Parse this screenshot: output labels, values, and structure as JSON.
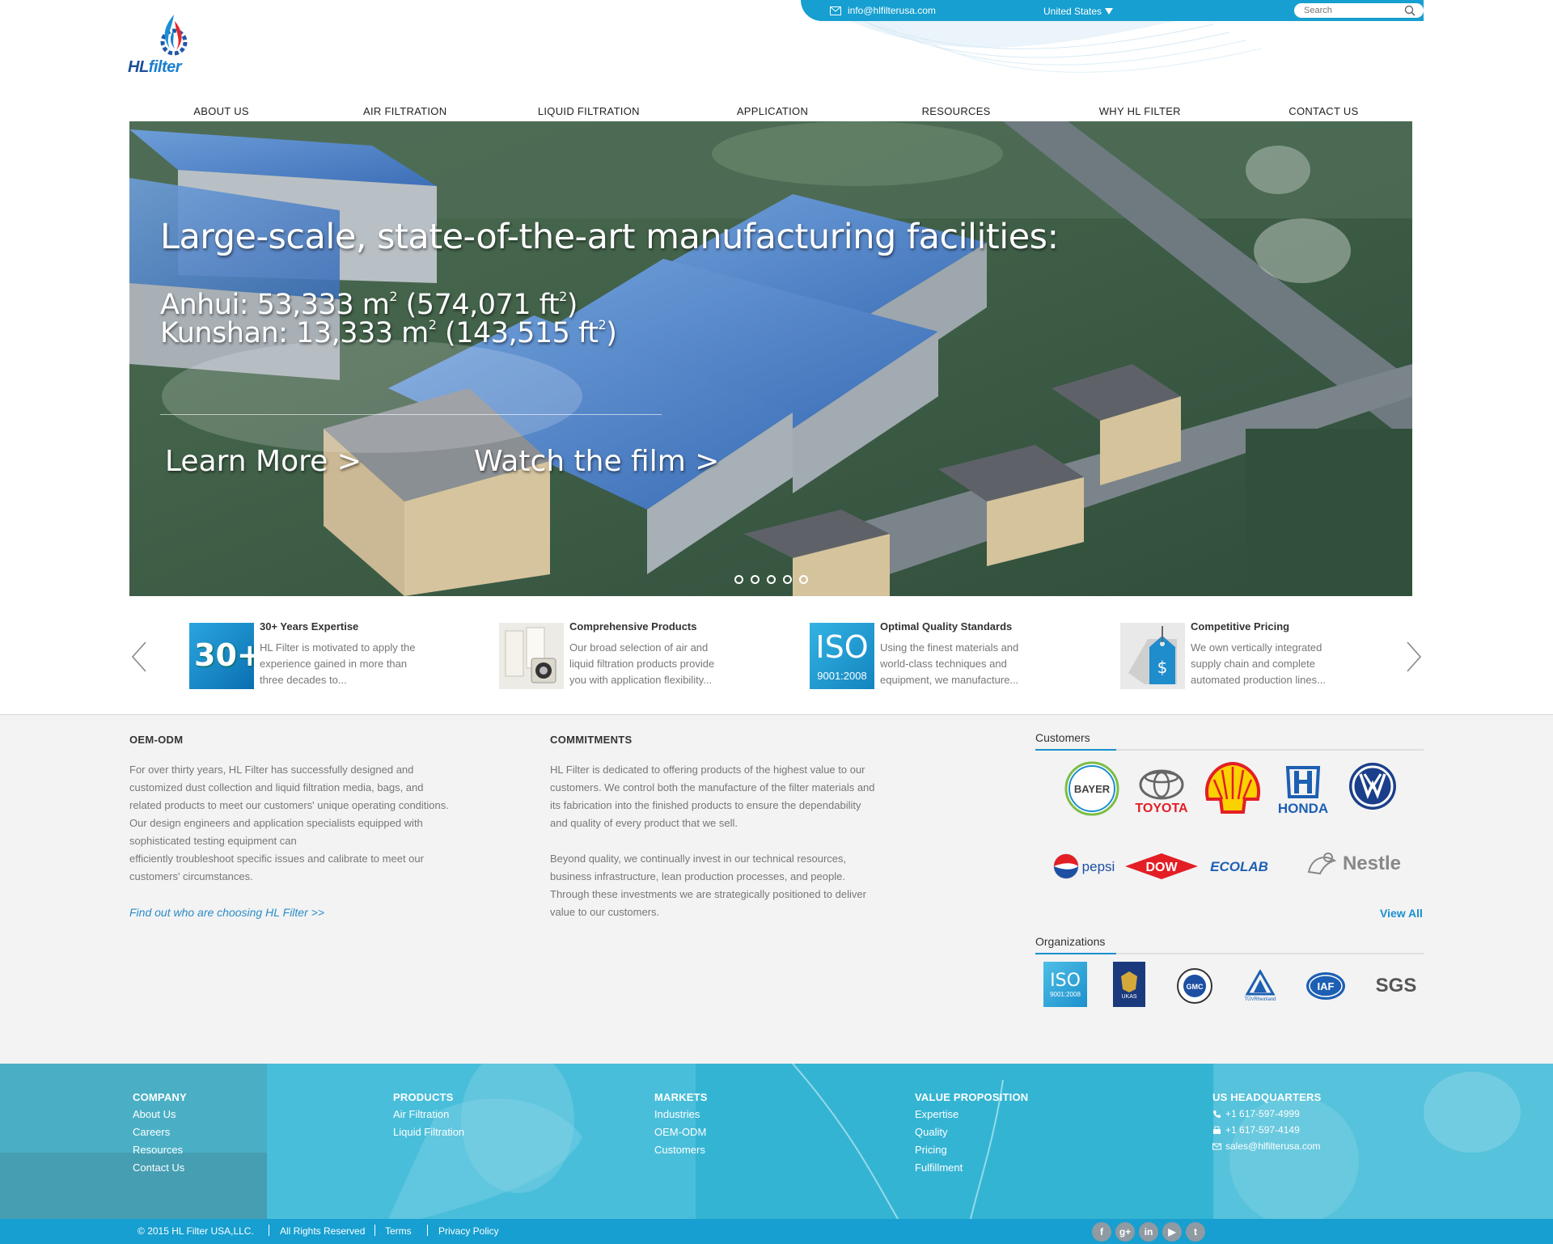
{
  "header": {
    "email": "info@hlfilterusa.com",
    "country": "United States",
    "search_placeholder": "Search",
    "logo_hl": "HL",
    "logo_filter": "filter"
  },
  "nav": [
    "ABOUT US",
    "AIR FILTRATION",
    "LIQUID FILTRATION",
    "APPLICATION",
    "RESOURCES",
    "WHY HL FILTER",
    "CONTACT US"
  ],
  "hero": {
    "title": "Large-scale, state-of-the-art manufacturing facilities:",
    "line1": "Anhui: 53,333 m",
    "line1_sup": "2",
    "line1_after": " (574,071 ft",
    "line1_sup2": "2",
    "line1_end": ")",
    "line2": "Kunshan: 13,333 m",
    "line2_sup": "2",
    "line2_after": " (143,515 ft",
    "line2_sup2": "2",
    "line2_end": ")",
    "cta_learn": "Learn More  >",
    "cta_film": "Watch the film  >"
  },
  "features": [
    {
      "title": "30+ Years Expertise",
      "desc": "HL Filter is motivated to apply the experience gained in more than three decades to...",
      "badge": "30+"
    },
    {
      "title": "Comprehensive Products",
      "desc": "Our broad selection of air and liquid filtration products provide you with application flexibility..."
    },
    {
      "title": "Optimal Quality Standards",
      "desc": "Using the finest materials and world-class techniques and equipment, we manufacture...",
      "badge": "ISO",
      "badge_sub": "9001:2008"
    },
    {
      "title": "Competitive Pricing",
      "desc": "We own vertically integrated supply chain and complete automated production lines...",
      "badge": "$"
    }
  ],
  "oem": {
    "title": "OEM-ODM",
    "lines": [
      "For over thirty years, HL Filter has successfully designed and",
      "customized dust collection and liquid filtration media, bags, and",
      "related products to meet our customers' unique operating conditions.",
      "Our design engineers and application specialists equipped with",
      "sophisticated testing equipment can",
      "efficiently troubleshoot specific issues and calibrate to meet our",
      "customers' circumstances."
    ],
    "link": "Find out who are choosing HL Filter >>"
  },
  "commitments": {
    "title": "COMMITMENTS",
    "lines": [
      "HL Filter is dedicated to offering products of the highest value to our",
      "customers.  We control both the manufacture of the filter materials and",
      "its fabrication into the finished products to ensure the dependability",
      "and quality of every product that we sell.",
      "",
      "Beyond quality, we continually invest in our technical resources,",
      "business infrastructure, lean production processes, and people.",
      "Through these investments we are strategically positioned to deliver",
      "value to our customers."
    ]
  },
  "customers": {
    "title": "Customers",
    "logos": [
      "BAYER",
      "TOYOTA",
      "Shell",
      "HONDA",
      "VW",
      "pepsi",
      "DOW",
      "ECOLAB",
      "Nestle"
    ],
    "view_all": "View All"
  },
  "organizations": {
    "title": "Organizations",
    "logos": [
      "ISO",
      "9001:2008",
      "UKAS",
      "GMC",
      "TÜVRheinland",
      "IAF",
      "SGS"
    ]
  },
  "footer": {
    "company": {
      "title": "COMPANY",
      "links": [
        "About Us",
        "Careers",
        "Resources",
        "Contact Us"
      ]
    },
    "products": {
      "title": "PRODUCTS",
      "links": [
        "Air Filtration",
        "Liquid Filtration"
      ]
    },
    "markets": {
      "title": "MARKETS",
      "links": [
        "Industries",
        "OEM-ODM",
        "Customers"
      ]
    },
    "value": {
      "title": "VALUE PROPOSITION",
      "links": [
        "Expertise",
        "Quality",
        "Pricing",
        "Fulfillment"
      ]
    },
    "hq": {
      "title": "US HEADQUARTERS",
      "phone": "+1 617-597-4999",
      "fax": "+1 617-597-4149",
      "email": "sales@hlfilterusa.com"
    }
  },
  "bottom": {
    "copyright": "2015  HL Filter USA,LLC.",
    "rights": "All Rights Reserved",
    "terms": "Terms",
    "privacy": "Privacy Policy",
    "social": [
      "f",
      "g+",
      "in",
      "▶",
      "t"
    ]
  },
  "colors": {
    "brand_blue": "#169fd0",
    "footer_teal": "#3db8d6",
    "link_blue": "#2a8dc7"
  }
}
